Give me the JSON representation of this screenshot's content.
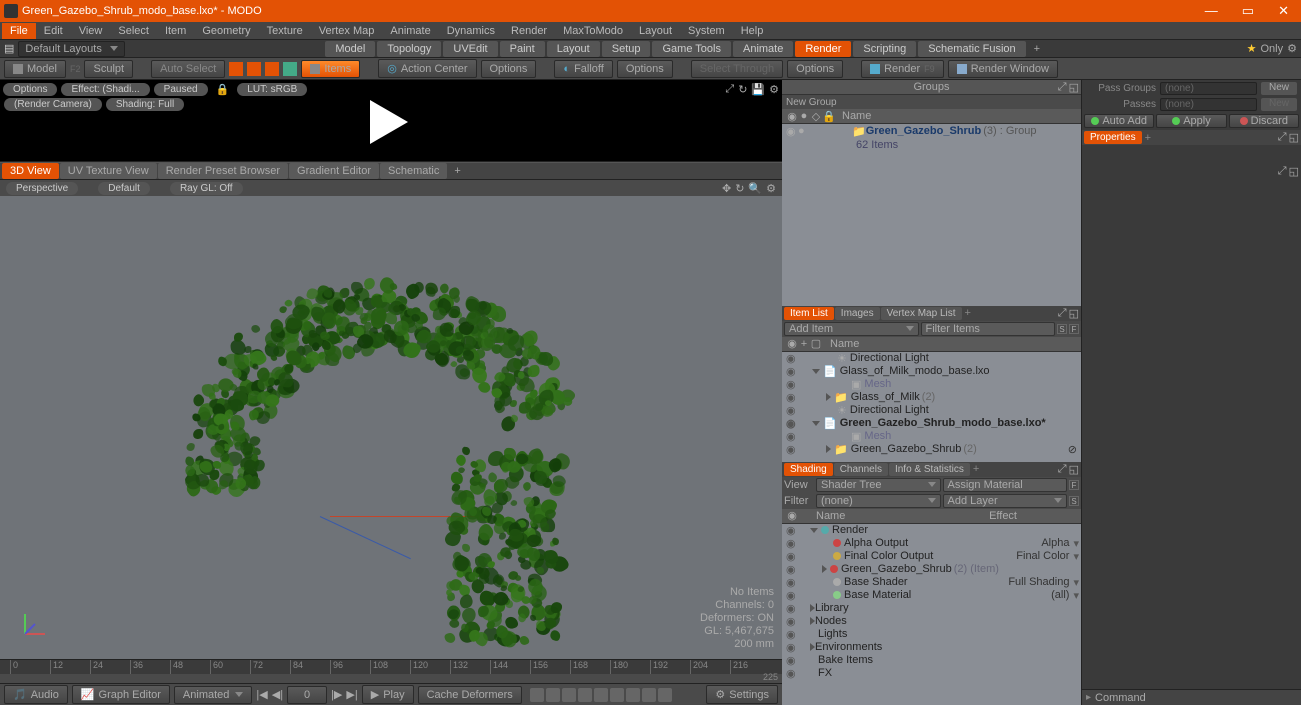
{
  "title": "Green_Gazebo_Shrub_modo_base.lxo* - MODO",
  "menu": [
    "File",
    "Edit",
    "View",
    "Select",
    "Item",
    "Geometry",
    "Texture",
    "Vertex Map",
    "Animate",
    "Dynamics",
    "Render",
    "MaxToModo",
    "Layout",
    "System",
    "Help"
  ],
  "layouts_dd": "Default Layouts",
  "layout_tabs": [
    "Model",
    "Topology",
    "UVEdit",
    "Paint",
    "Layout",
    "Setup",
    "Game Tools",
    "Animate",
    "Render",
    "Scripting",
    "Schematic Fusion"
  ],
  "layout_active": "Render",
  "only": "Only",
  "toolbar": {
    "model": "Model",
    "sculpt": "Sculpt",
    "auto_select": "Auto Select",
    "items": "Items",
    "action_center": "Action Center",
    "options": "Options",
    "falloff": "Falloff",
    "select_through": "Select Through",
    "render": "Render",
    "render_window": "Render Window"
  },
  "preview": {
    "options": "Options",
    "effect": "Effect: (Shadi...",
    "paused": "Paused",
    "lut": "LUT: sRGB",
    "camera": "(Render Camera)",
    "shading": "Shading: Full"
  },
  "view_tabs": [
    "3D View",
    "UV Texture View",
    "Render Preset Browser",
    "Gradient Editor",
    "Schematic"
  ],
  "view_active": "3D View",
  "vbar": {
    "persp": "Perspective",
    "default": "Default",
    "raygl": "Ray GL: Off"
  },
  "stats": {
    "l1": "No Items",
    "l2": "Channels: 0",
    "l3": "Deformers: ON",
    "l4": "GL: 5,467,675",
    "l5": "200 mm"
  },
  "timeline_ticks": [
    "0",
    "12",
    "24",
    "36",
    "48",
    "60",
    "72",
    "84",
    "96",
    "108",
    "120",
    "132",
    "144",
    "156",
    "168",
    "180",
    "192",
    "204",
    "216"
  ],
  "timeline_end": "225",
  "anim": {
    "audio": "Audio",
    "graph": "Graph Editor",
    "mode": "Animated",
    "frame": "0",
    "play": "Play",
    "cache": "Cache Deformers",
    "settings": "Settings"
  },
  "groups": {
    "title": "Groups",
    "new": "New Group",
    "name_col": "Name",
    "item": "Green_Gazebo_Shrub",
    "meta": "(3) : Group",
    "count": "62 Items"
  },
  "item_list": {
    "tabs": [
      "Item List",
      "Images",
      "Vertex Map List"
    ],
    "active": "Item List",
    "add": "Add Item",
    "filter": "Filter Items",
    "name_col": "Name",
    "rows": [
      {
        "ind": 2,
        "icon": "light",
        "label": "Directional Light"
      },
      {
        "ind": 1,
        "icon": "file",
        "label": "Glass_of_Milk_modo_base.lxo",
        "exp": "d"
      },
      {
        "ind": 3,
        "icon": "mesh",
        "label": "Mesh",
        "dim": true
      },
      {
        "ind": 2,
        "icon": "grp",
        "label": "Glass_of_Milk",
        "meta": "(2)",
        "exp": "r"
      },
      {
        "ind": 2,
        "icon": "light",
        "label": "Directional Light"
      },
      {
        "ind": 1,
        "icon": "file",
        "label": "Green_Gazebo_Shrub_modo_base.lxo*",
        "bold": true,
        "exp": "d"
      },
      {
        "ind": 3,
        "icon": "mesh",
        "label": "Mesh",
        "dim": true
      },
      {
        "ind": 2,
        "icon": "grp",
        "label": "Green_Gazebo_Shrub",
        "meta": "(2)",
        "exp": "r",
        "close": true
      }
    ]
  },
  "shading": {
    "tabs": [
      "Shading",
      "Channels",
      "Info & Statistics"
    ],
    "active": "Shading",
    "view": "View",
    "view_v": "Shader Tree",
    "assign": "Assign Material",
    "filter": "Filter",
    "filter_v": "(none)",
    "addlayer": "Add Layer",
    "name_col": "Name",
    "effect_col": "Effect",
    "rows": [
      {
        "ind": 1,
        "label": "Render",
        "exp": "d",
        "ball": "#5aa"
      },
      {
        "ind": 2,
        "label": "Alpha Output",
        "eff": "Alpha",
        "ball": "#c44"
      },
      {
        "ind": 2,
        "label": "Final Color Output",
        "eff": "Final Color",
        "ball": "#ca4"
      },
      {
        "ind": 2,
        "label": "Green_Gazebo_Shrub",
        "meta": "(2) (Item)",
        "ball": "#c44",
        "exp": "r"
      },
      {
        "ind": 2,
        "label": "Base Shader",
        "eff": "Full Shading",
        "ball": "#aaa"
      },
      {
        "ind": 2,
        "label": "Base Material",
        "eff": "(all)",
        "ball": "#8c8"
      },
      {
        "ind": 1,
        "label": "Library",
        "exp": "r"
      },
      {
        "ind": 1,
        "label": "Nodes",
        "exp": "r"
      },
      {
        "ind": 1,
        "label": "Lights"
      },
      {
        "ind": 1,
        "label": "Environments",
        "exp": "r"
      },
      {
        "ind": 1,
        "label": "Bake Items"
      },
      {
        "ind": 1,
        "label": "FX"
      }
    ]
  },
  "pass": {
    "groups": "Pass Groups",
    "groups_v": "(none)",
    "passes": "Passes",
    "passes_v": "(none)",
    "new": "New"
  },
  "actions": {
    "auto": "Auto Add",
    "apply": "Apply",
    "discard": "Discard"
  },
  "props": "Properties",
  "cmd": "Command"
}
